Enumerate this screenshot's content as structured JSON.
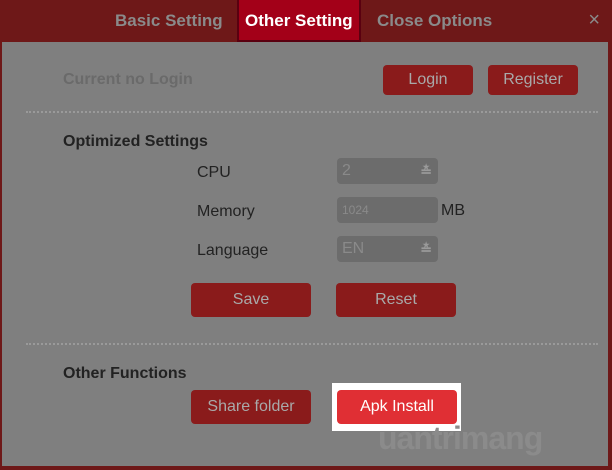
{
  "tabs": [
    {
      "label": "Basic Setting"
    },
    {
      "label": "Other Setting"
    },
    {
      "label": "Close Options"
    }
  ],
  "close_icon": "×",
  "account": {
    "status": "Current no Login",
    "login": "Login",
    "register": "Register"
  },
  "optimized": {
    "title": "Optimized Settings",
    "cpu_label": "CPU",
    "cpu_value": "2",
    "memory_label": "Memory",
    "memory_value": "1024",
    "memory_unit": "MB",
    "language_label": "Language",
    "language_value": "EN",
    "save": "Save",
    "reset": "Reset"
  },
  "other": {
    "title": "Other Functions",
    "share_folder": "Share folder",
    "apk_install": "Apk Install"
  },
  "watermark": "uantrimang"
}
